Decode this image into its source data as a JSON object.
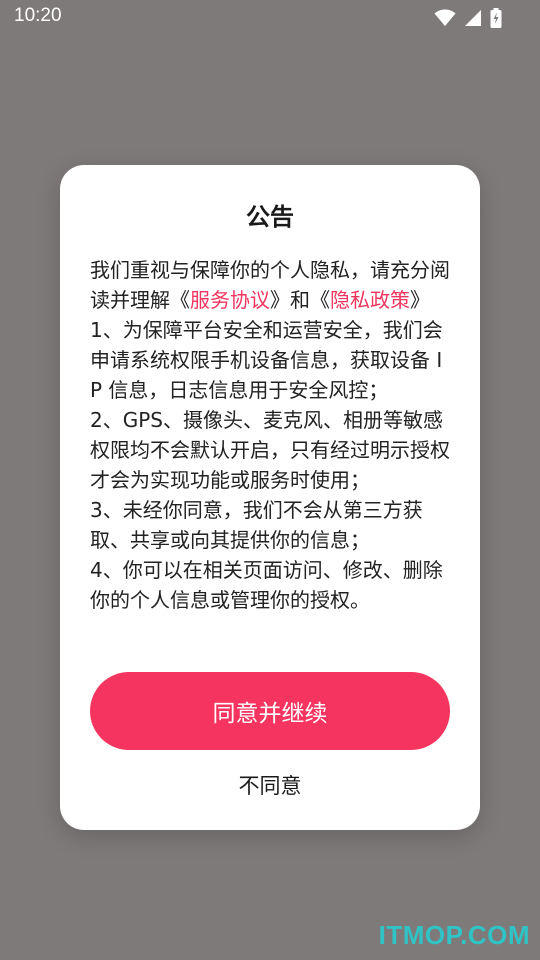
{
  "status_bar": {
    "time": "10:20",
    "icons": [
      "wifi-icon",
      "signal-icon",
      "battery-charging-icon"
    ]
  },
  "dialog": {
    "title": "公告",
    "intro_prefix": "我们重视与保障你的个人隐私，请充分阅读并理解《",
    "service_agreement_link": "服务协议",
    "intro_middle": "》和《",
    "privacy_policy_link": "隐私政策",
    "intro_suffix": "》",
    "items": [
      "1、为保障平台安全和运营安全，我们会申请系统权限手机设备信息，获取设备 IP 信息，日志信息用于安全风控；",
      "2、GPS、摄像头、麦克风、相册等敏感权限均不会默认开启，只有经过明示授权才会为实现功能或服务时使用；",
      "3、未经你同意，我们不会从第三方获取、共享或向其提供你的信息；",
      "4、你可以在相关页面访问、修改、删除你的个人信息或管理你的授权。"
    ],
    "agree_label": "同意并继续",
    "disagree_label": "不同意"
  },
  "watermark": "ITMOP.COM",
  "colors": {
    "accent": "#f5345f",
    "link": "#f0355e",
    "overlay": "#7e7a7a",
    "watermark": "#2fc3c6"
  }
}
